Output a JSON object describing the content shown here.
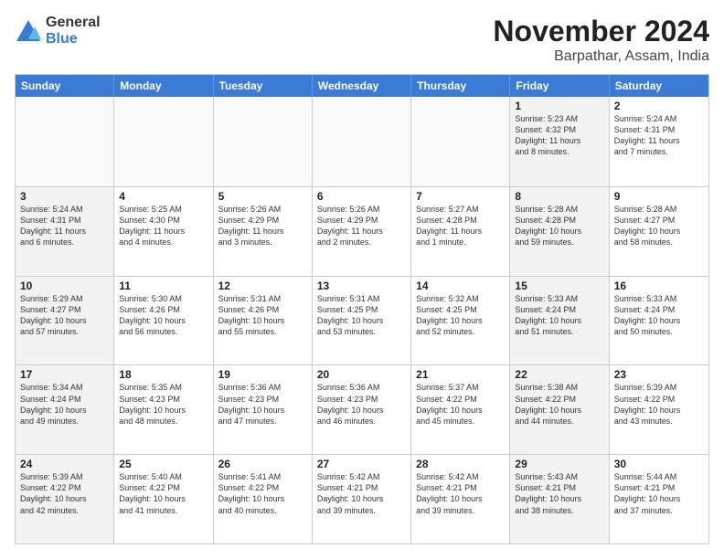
{
  "logo": {
    "general": "General",
    "blue": "Blue"
  },
  "header": {
    "month": "November 2024",
    "location": "Barpathar, Assam, India"
  },
  "weekdays": [
    "Sunday",
    "Monday",
    "Tuesday",
    "Wednesday",
    "Thursday",
    "Friday",
    "Saturday"
  ],
  "rows": [
    [
      {
        "day": "",
        "text": "",
        "empty": true
      },
      {
        "day": "",
        "text": "",
        "empty": true
      },
      {
        "day": "",
        "text": "",
        "empty": true
      },
      {
        "day": "",
        "text": "",
        "empty": true
      },
      {
        "day": "",
        "text": "",
        "empty": true
      },
      {
        "day": "1",
        "text": "Sunrise: 5:23 AM\nSunset: 4:32 PM\nDaylight: 11 hours\nand 8 minutes.",
        "shaded": true
      },
      {
        "day": "2",
        "text": "Sunrise: 5:24 AM\nSunset: 4:31 PM\nDaylight: 11 hours\nand 7 minutes.",
        "shaded": false
      }
    ],
    [
      {
        "day": "3",
        "text": "Sunrise: 5:24 AM\nSunset: 4:31 PM\nDaylight: 11 hours\nand 6 minutes.",
        "shaded": true
      },
      {
        "day": "4",
        "text": "Sunrise: 5:25 AM\nSunset: 4:30 PM\nDaylight: 11 hours\nand 4 minutes.",
        "shaded": false
      },
      {
        "day": "5",
        "text": "Sunrise: 5:26 AM\nSunset: 4:29 PM\nDaylight: 11 hours\nand 3 minutes.",
        "shaded": false
      },
      {
        "day": "6",
        "text": "Sunrise: 5:26 AM\nSunset: 4:29 PM\nDaylight: 11 hours\nand 2 minutes.",
        "shaded": false
      },
      {
        "day": "7",
        "text": "Sunrise: 5:27 AM\nSunset: 4:28 PM\nDaylight: 11 hours\nand 1 minute.",
        "shaded": false
      },
      {
        "day": "8",
        "text": "Sunrise: 5:28 AM\nSunset: 4:28 PM\nDaylight: 10 hours\nand 59 minutes.",
        "shaded": true
      },
      {
        "day": "9",
        "text": "Sunrise: 5:28 AM\nSunset: 4:27 PM\nDaylight: 10 hours\nand 58 minutes.",
        "shaded": false
      }
    ],
    [
      {
        "day": "10",
        "text": "Sunrise: 5:29 AM\nSunset: 4:27 PM\nDaylight: 10 hours\nand 57 minutes.",
        "shaded": true
      },
      {
        "day": "11",
        "text": "Sunrise: 5:30 AM\nSunset: 4:26 PM\nDaylight: 10 hours\nand 56 minutes.",
        "shaded": false
      },
      {
        "day": "12",
        "text": "Sunrise: 5:31 AM\nSunset: 4:26 PM\nDaylight: 10 hours\nand 55 minutes.",
        "shaded": false
      },
      {
        "day": "13",
        "text": "Sunrise: 5:31 AM\nSunset: 4:25 PM\nDaylight: 10 hours\nand 53 minutes.",
        "shaded": false
      },
      {
        "day": "14",
        "text": "Sunrise: 5:32 AM\nSunset: 4:25 PM\nDaylight: 10 hours\nand 52 minutes.",
        "shaded": false
      },
      {
        "day": "15",
        "text": "Sunrise: 5:33 AM\nSunset: 4:24 PM\nDaylight: 10 hours\nand 51 minutes.",
        "shaded": true
      },
      {
        "day": "16",
        "text": "Sunrise: 5:33 AM\nSunset: 4:24 PM\nDaylight: 10 hours\nand 50 minutes.",
        "shaded": false
      }
    ],
    [
      {
        "day": "17",
        "text": "Sunrise: 5:34 AM\nSunset: 4:24 PM\nDaylight: 10 hours\nand 49 minutes.",
        "shaded": true
      },
      {
        "day": "18",
        "text": "Sunrise: 5:35 AM\nSunset: 4:23 PM\nDaylight: 10 hours\nand 48 minutes.",
        "shaded": false
      },
      {
        "day": "19",
        "text": "Sunrise: 5:36 AM\nSunset: 4:23 PM\nDaylight: 10 hours\nand 47 minutes.",
        "shaded": false
      },
      {
        "day": "20",
        "text": "Sunrise: 5:36 AM\nSunset: 4:23 PM\nDaylight: 10 hours\nand 46 minutes.",
        "shaded": false
      },
      {
        "day": "21",
        "text": "Sunrise: 5:37 AM\nSunset: 4:22 PM\nDaylight: 10 hours\nand 45 minutes.",
        "shaded": false
      },
      {
        "day": "22",
        "text": "Sunrise: 5:38 AM\nSunset: 4:22 PM\nDaylight: 10 hours\nand 44 minutes.",
        "shaded": true
      },
      {
        "day": "23",
        "text": "Sunrise: 5:39 AM\nSunset: 4:22 PM\nDaylight: 10 hours\nand 43 minutes.",
        "shaded": false
      }
    ],
    [
      {
        "day": "24",
        "text": "Sunrise: 5:39 AM\nSunset: 4:22 PM\nDaylight: 10 hours\nand 42 minutes.",
        "shaded": true
      },
      {
        "day": "25",
        "text": "Sunrise: 5:40 AM\nSunset: 4:22 PM\nDaylight: 10 hours\nand 41 minutes.",
        "shaded": false
      },
      {
        "day": "26",
        "text": "Sunrise: 5:41 AM\nSunset: 4:22 PM\nDaylight: 10 hours\nand 40 minutes.",
        "shaded": false
      },
      {
        "day": "27",
        "text": "Sunrise: 5:42 AM\nSunset: 4:21 PM\nDaylight: 10 hours\nand 39 minutes.",
        "shaded": false
      },
      {
        "day": "28",
        "text": "Sunrise: 5:42 AM\nSunset: 4:21 PM\nDaylight: 10 hours\nand 39 minutes.",
        "shaded": false
      },
      {
        "day": "29",
        "text": "Sunrise: 5:43 AM\nSunset: 4:21 PM\nDaylight: 10 hours\nand 38 minutes.",
        "shaded": true
      },
      {
        "day": "30",
        "text": "Sunrise: 5:44 AM\nSunset: 4:21 PM\nDaylight: 10 hours\nand 37 minutes.",
        "shaded": false
      }
    ]
  ]
}
